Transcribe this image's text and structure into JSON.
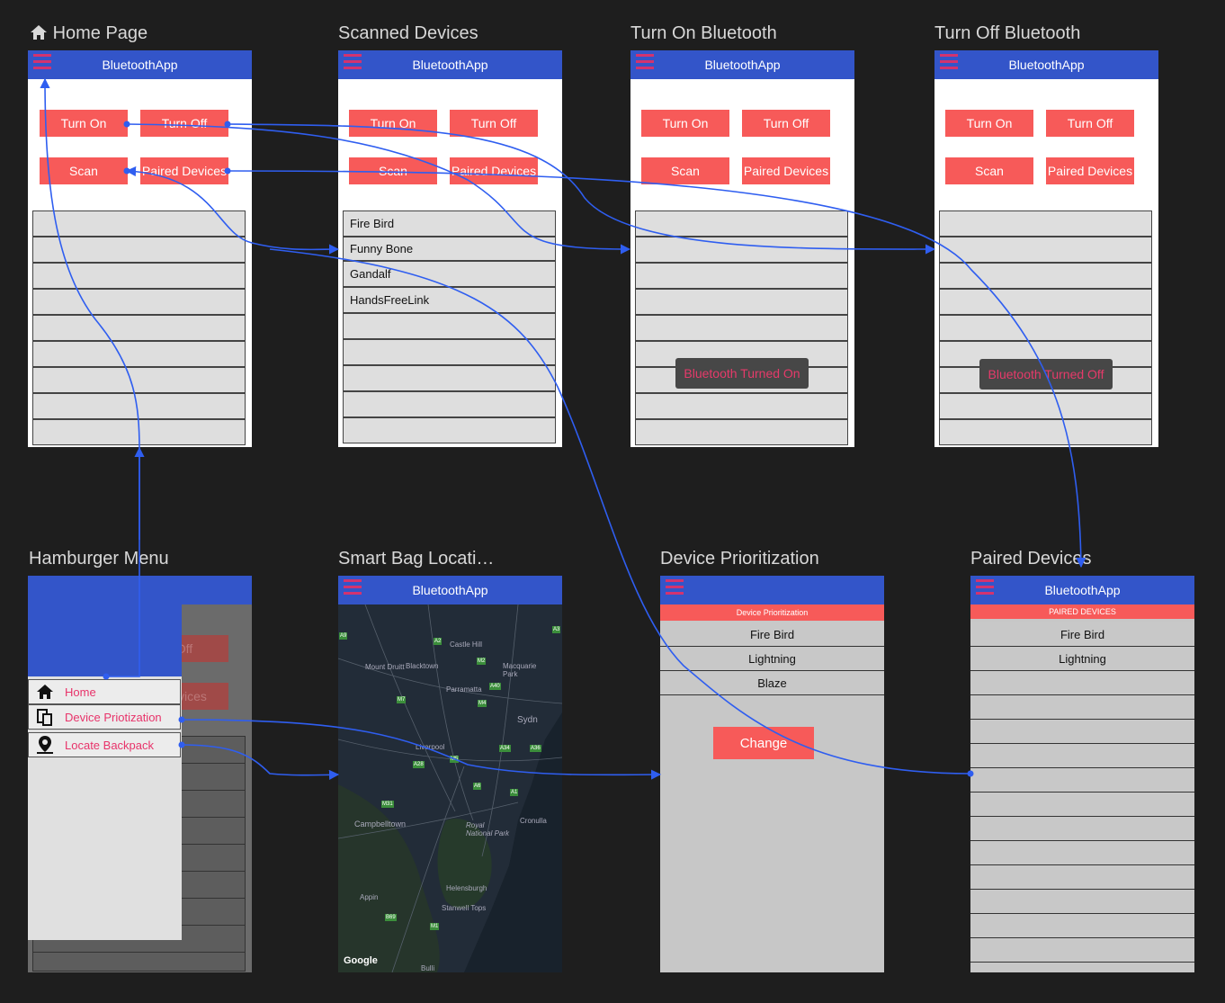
{
  "app_name": "BluetoothApp",
  "screens": {
    "home": {
      "title": "Home Page"
    },
    "scanned": {
      "title": "Scanned Devices",
      "devices": [
        "Fire Bird",
        "Funny Bone",
        "Gandalf",
        "HandsFreeLink"
      ]
    },
    "turn_on": {
      "title": "Turn On Bluetooth",
      "toast": "Bluetooth Turned On"
    },
    "turn_off": {
      "title": "Turn Off Bluetooth",
      "toast": "Bluetooth Turned Off"
    },
    "hamburger": {
      "title": "Hamburger Menu",
      "items": [
        "Home",
        "Device Priotization",
        "Locate Backpack"
      ],
      "bg_button_1": "Off",
      "bg_button_2": "Devices"
    },
    "map": {
      "title": "Smart Bag Locati…",
      "google": "Google",
      "places": [
        "Castle Hill",
        "Mount Druitt",
        "Blacktown",
        "Macquarie Park",
        "Parramatta",
        "Sydn",
        "Liverpool",
        "Campbelltown",
        "Royal National Park",
        "Cronulla",
        "Appin",
        "Helensburgh",
        "Stanwell Tops",
        "Bulli"
      ],
      "roads": [
        "A2",
        "M2",
        "A40",
        "M7",
        "M4",
        "A34",
        "A36",
        "A28",
        "M5",
        "A6",
        "A1",
        "M31",
        "B69",
        "M1",
        "A3",
        "A9"
      ]
    },
    "priority": {
      "title": "Device Prioritization",
      "header": "Device Prioritization",
      "devices": [
        "Fire Bird",
        "Lightning",
        "Blaze"
      ],
      "button": "Change"
    },
    "paired": {
      "title": "Paired Devices",
      "header": "PAIRED DEVICES",
      "devices": [
        "Fire Bird",
        "Lightning"
      ]
    }
  },
  "buttons": {
    "turn_on": "Turn On",
    "turn_off": "Turn Off",
    "scan": "Scan",
    "paired": "Paired Devices"
  },
  "colors": {
    "app_bar": "#3355c9",
    "accent": "#f75a59",
    "hamburger": "#d3336f",
    "flow_arrow": "#2f5ef0"
  }
}
